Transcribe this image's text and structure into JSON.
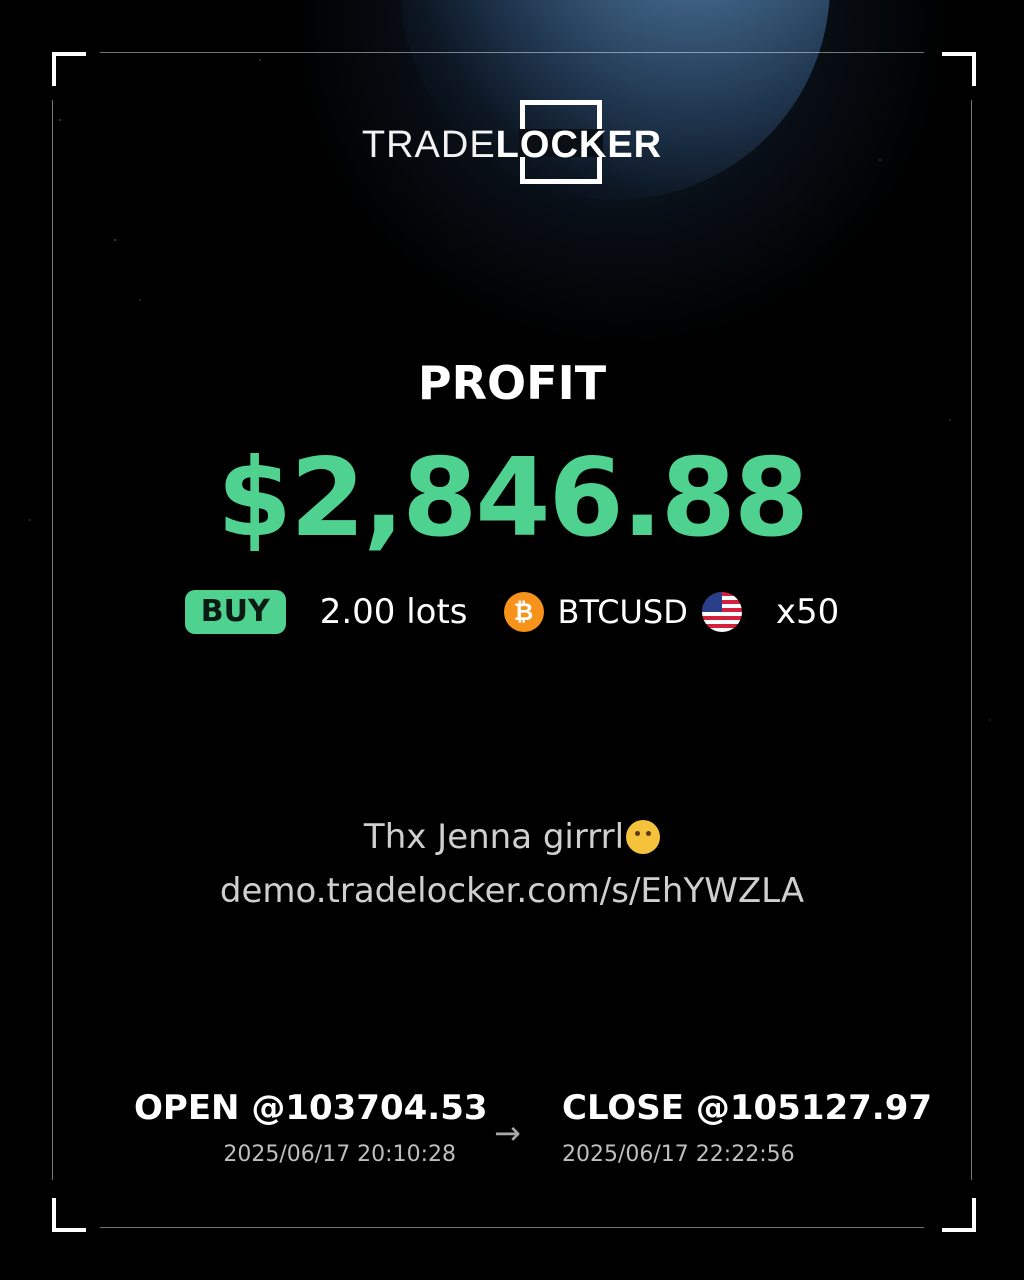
{
  "brand": {
    "light": "TRADE",
    "bold": "LOCKER"
  },
  "result_label": "PROFIT",
  "profit": "$2,846.88",
  "trade": {
    "side": "BUY",
    "lots": "2.00 lots",
    "coin_icon": "bitcoin-icon",
    "symbol": "BTCUSD",
    "flag_icon": "us-flag-icon",
    "leverage": "x50"
  },
  "note": {
    "message": "Thx Jenna girrrl",
    "emoji_icon": "hugging-face-emoji",
    "url": "demo.tradelocker.com/s/EhYWZLA"
  },
  "open": {
    "label": "OPEN @103704.53",
    "time": "2025/06/17 20:10:28"
  },
  "close": {
    "label": "CLOSE @105127.97",
    "time": "2025/06/17 22:22:56"
  },
  "colors": {
    "profit": "#4fd28f",
    "background": "#000000"
  }
}
